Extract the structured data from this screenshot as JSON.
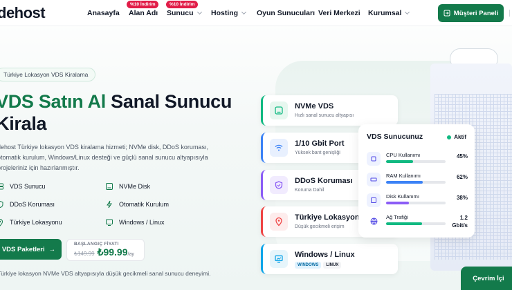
{
  "nav": {
    "logo": "dehost",
    "items": [
      {
        "label": "Anasayfa",
        "dropdown": false
      },
      {
        "label": "Alan Adı",
        "dropdown": false,
        "badge": "%10 İndirim"
      },
      {
        "label": "Sunucu",
        "dropdown": true,
        "badge": "%10 İndirim"
      },
      {
        "label": "Hosting",
        "dropdown": true
      },
      {
        "label": "Oyun Sunucuları",
        "dropdown": false
      },
      {
        "label": "Veri Merkezi",
        "dropdown": false
      },
      {
        "label": "Kurumsal",
        "dropdown": true
      }
    ],
    "panel_button": "Müşteri Paneli"
  },
  "hero": {
    "pill": "Türkiye Lokasyon VDS Kiralama",
    "title_green": "VDS Satın Al",
    "title_dark": " Sanal Sunucu",
    "title_line2": "Kirala",
    "description": "dehost Türkiye lokasyon VDS kiralama hizmeti; NVMe disk, DDoS koruması, otomatik kurulum, Windows/Linux desteği ve güçlü sanal sunucu altyapısıyla projeleriniz için hazırlanmıştır.",
    "features": [
      {
        "label": "VDS Sunucu",
        "icon": "server-icon"
      },
      {
        "label": "NVMe Disk",
        "icon": "disk-icon"
      },
      {
        "label": "DDoS Koruması",
        "icon": "shield-icon"
      },
      {
        "label": "Otomatik Kurulum",
        "icon": "bolt-icon"
      },
      {
        "label": "Türkiye Lokasyonu",
        "icon": "location-icon"
      },
      {
        "label": "Windows / Linux",
        "icon": "monitor-icon"
      }
    ],
    "cta": "VDS Paketleri",
    "price": {
      "label": "BAŞLANGIÇ FİYATI",
      "old": "₺149.99",
      "new": "₺99.99",
      "per": "/ay"
    },
    "footnote": "Türkiye lokasyon NVMe VDS altyapısıyla düşük gecikmeli sanal sunucu deneyimi."
  },
  "cards": [
    {
      "title": "NVMe VDS",
      "subtitle": "Hızlı sanal sunucu altyapısı",
      "accent": "#10b981",
      "icon": "disk-icon"
    },
    {
      "title": "1/10 Gbit Port",
      "subtitle": "Yüksek bant genişliği",
      "accent": "#3b82f6",
      "icon": "wifi-icon"
    },
    {
      "title": "DDoS Koruması",
      "subtitle": "Koruma Dahil",
      "accent": "#8b5cf6",
      "icon": "shield-icon"
    },
    {
      "title": "Türkiye Lokasyonu",
      "subtitle": "Düşük gecikmeli erişim",
      "accent": "#ef4444",
      "icon": "location-icon"
    },
    {
      "title": "Windows / Linux",
      "tags": [
        "WINDOWS",
        "LINUX"
      ],
      "accent": "#0ea5e9",
      "icon": "monitor-icon"
    }
  ],
  "vds_panel": {
    "title": "VDS Sunucunuz",
    "status": "Aktif",
    "metrics": [
      {
        "label": "CPU Kullanımı",
        "value": "45%",
        "fill": 0.45,
        "color": "#10b981"
      },
      {
        "label": "RAM Kullanımı",
        "value": "62%",
        "fill": 0.62,
        "color": "#3b82f6"
      },
      {
        "label": "Disk Kullanımı",
        "value": "38%",
        "fill": 0.38,
        "color": "#8b5cf6"
      },
      {
        "label": "Ağ Trafiği",
        "value": "1.2\nGbit/s",
        "fill": 0.6,
        "color": "#10b981"
      }
    ]
  },
  "chat_button": "Çevrim İçi"
}
